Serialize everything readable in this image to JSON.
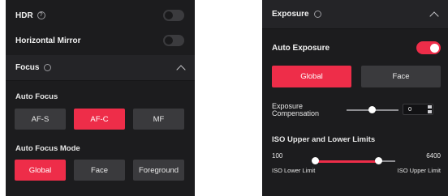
{
  "left": {
    "hdr_label": "HDR",
    "hdr_info_glyph": "?",
    "mirror_label": "Horizontal Mirror",
    "focus_label": "Focus",
    "auto_focus_label": "Auto Focus",
    "af_buttons": [
      {
        "label": "AF-S",
        "active": false
      },
      {
        "label": "AF-C",
        "active": true
      },
      {
        "label": "MF",
        "active": false
      }
    ],
    "mode_label": "Auto Focus Mode",
    "mode_buttons": [
      {
        "label": "Global",
        "active": true
      },
      {
        "label": "Face",
        "active": false
      },
      {
        "label": "Foreground",
        "active": false
      }
    ],
    "hdr_on": false,
    "mirror_on": false
  },
  "right": {
    "exposure_label": "Exposure",
    "auto_exposure_label": "Auto Exposure",
    "auto_exposure_on": true,
    "metering_buttons": [
      {
        "label": "Global",
        "active": true
      },
      {
        "label": "Face",
        "active": false
      }
    ],
    "comp_label_line1": "Exposure",
    "comp_label_line2": "Compensation",
    "comp_value": "0",
    "iso_label": "ISO Upper and Lower Limits",
    "iso_min": "100",
    "iso_max": "6400",
    "iso_lower_label": "ISO Lower Limit",
    "iso_upper_label": "ISO Upper Limit"
  },
  "colors": {
    "accent": "#ee2d49",
    "panel": "#1c1c1e",
    "button": "#3a3a3d"
  },
  "icons": [
    "info-icon",
    "refresh-circle-icon",
    "chevron-up-icon",
    "stepper-arrows-icon"
  ]
}
